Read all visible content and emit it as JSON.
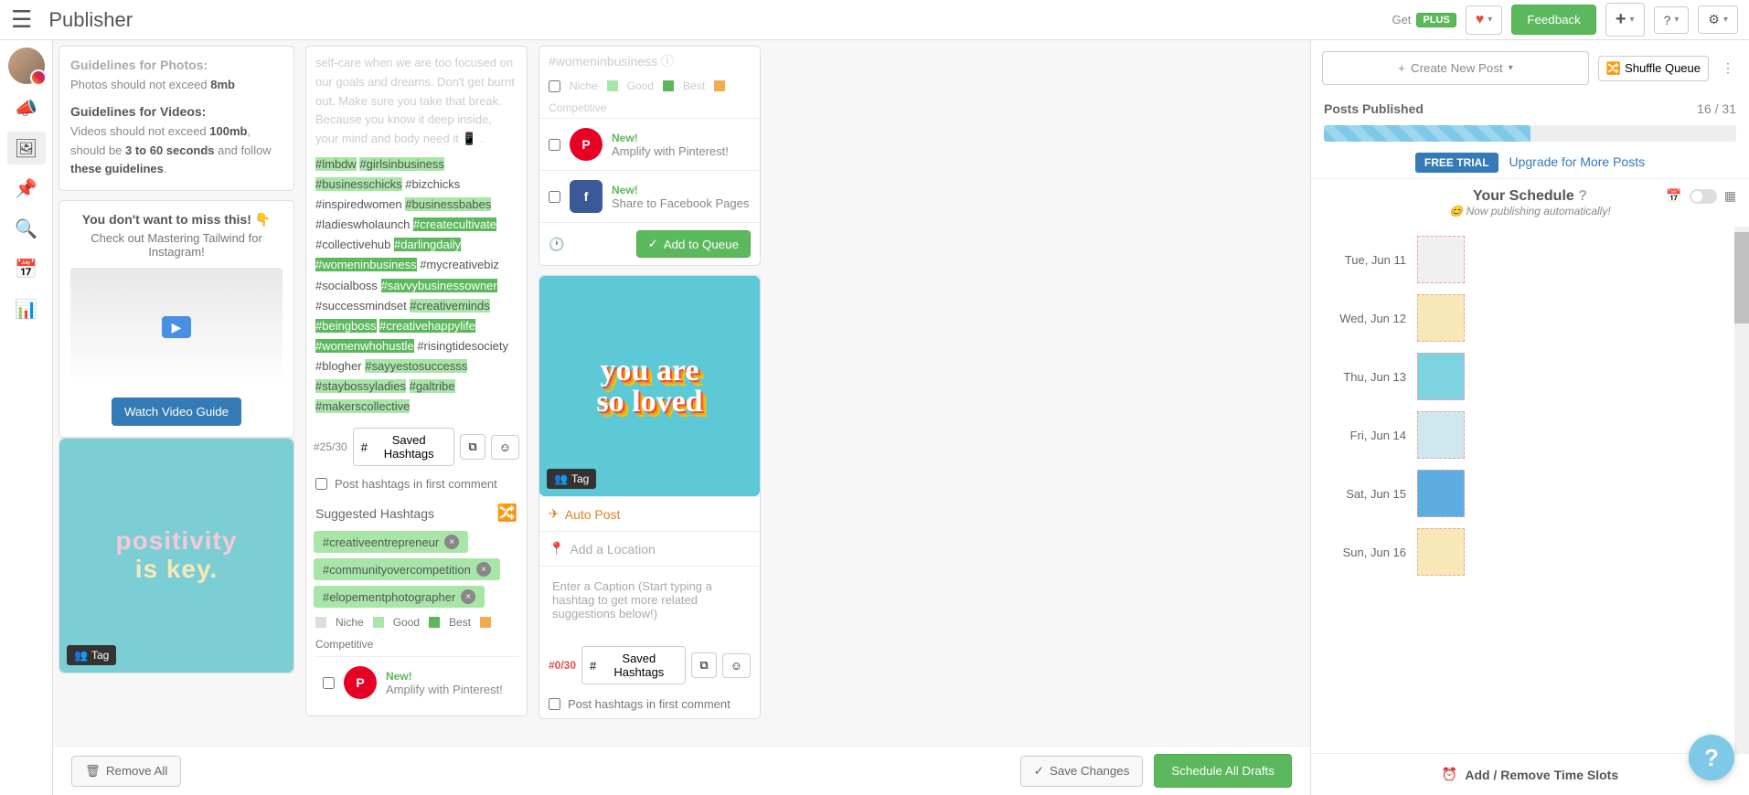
{
  "header": {
    "title": "Publisher",
    "get": "Get",
    "plus": "PLUS",
    "feedback": "Feedback"
  },
  "guidelines": {
    "photos_title": "Guidelines for Photos:",
    "photos_text_a": "Photos should not exceed ",
    "photos_text_b": "8mb",
    "videos_title": "Guidelines for Videos:",
    "videos_a": "Videos should not exceed ",
    "videos_b": "100mb",
    "videos_c": ", should be ",
    "videos_d": "3 to 60 seconds",
    "videos_e": " and follow ",
    "videos_f": "these guidelines",
    "videos_g": "."
  },
  "promo": {
    "title": "You don't want to miss this! ",
    "sub": "Check out Mastering Tailwind for Instagram!",
    "btn": "Watch Video Guide"
  },
  "img": {
    "positivity_a": "positivity",
    "positivity_b": "is key.",
    "loved_a": "you are",
    "loved_b": "so loved",
    "tag": "Tag"
  },
  "caption": {
    "body": "self-care when we are too focused on our goals and dreams. Don't get burnt out. Make sure you take that break. Because you know it deep inside, your mind and body need it 📱 ."
  },
  "hashtags_list": [
    {
      "t": "#lmbdw",
      "c": "green"
    },
    {
      "t": "#girlsinbusiness",
      "c": "green"
    },
    {
      "t": "#businesschicks",
      "c": "green"
    },
    {
      "t": "#bizchicks",
      "c": ""
    },
    {
      "t": "#inspiredwomen",
      "c": ""
    },
    {
      "t": "#businessbabes",
      "c": "green"
    },
    {
      "t": "#ladieswholaunch",
      "c": ""
    },
    {
      "t": "#createcultivate",
      "c": "darkgreen"
    },
    {
      "t": "#collectivehub",
      "c": ""
    },
    {
      "t": "#darlingdaily",
      "c": "darkgreen"
    },
    {
      "t": "#womeninbusiness",
      "c": "darkgreen"
    },
    {
      "t": "#mycreativebiz",
      "c": ""
    },
    {
      "t": "#socialboss",
      "c": ""
    },
    {
      "t": "#savvybusinessowner",
      "c": "darkgreen"
    },
    {
      "t": "#successmindset",
      "c": ""
    },
    {
      "t": "#creativeminds",
      "c": "green"
    },
    {
      "t": "#beingboss",
      "c": "darkgreen"
    },
    {
      "t": "#creativehappylife",
      "c": "darkgreen"
    },
    {
      "t": "#womenwhohustle",
      "c": "darkgreen"
    },
    {
      "t": "#risingtidesociety",
      "c": ""
    },
    {
      "t": "#blogher",
      "c": ""
    },
    {
      "t": "#sayyestosuccesss",
      "c": "green"
    },
    {
      "t": "#staybossyladies",
      "c": "green"
    },
    {
      "t": "#galtribe",
      "c": "green"
    },
    {
      "t": "#makerscollective",
      "c": "green"
    }
  ],
  "ctrls": {
    "count": "#25/30",
    "saved": "Saved Hashtags",
    "post_first": "Post hashtags in first comment",
    "suggested": "Suggested Hashtags"
  },
  "chips": [
    "#creativeentrepreneur",
    "#communityovercompetition",
    "#elopementphotographer"
  ],
  "legend": {
    "niche": "Niche",
    "good": "Good",
    "best": "Best",
    "comp": "Competitive"
  },
  "share": {
    "new": "New!",
    "pin": "Amplify with Pinterest!",
    "fb": "Share to Facebook Pages",
    "queue": "Add to Queue"
  },
  "post3": {
    "auto": "Auto Post",
    "loc": "Add a Location",
    "caption_ph": "Enter a Caption (Start typing a hashtag to get more related suggestions below!)",
    "count": "#0/30"
  },
  "right": {
    "create": "Create New Post",
    "shuffle": "Shuffle Queue",
    "published": "Posts Published",
    "pub_count": "16 / 31",
    "trial": "FREE TRIAL",
    "upgrade": "Upgrade for More Posts",
    "sched": "Your Schedule",
    "sched_sub": "Now publishing automatically!",
    "add_slots": "Add / Remove Time Slots"
  },
  "schedule": [
    {
      "d": "Tue, Jun 11",
      "c": "th1"
    },
    {
      "d": "Wed, Jun 12",
      "c": "th2"
    },
    {
      "d": "Thu, Jun 13",
      "c": "th3"
    },
    {
      "d": "Fri, Jun 14",
      "c": "th4"
    },
    {
      "d": "Sat, Jun 15",
      "c": "th5"
    },
    {
      "d": "Sun, Jun 16",
      "c": "th6"
    }
  ],
  "footer": {
    "remove": "Remove All",
    "save": "Save Changes",
    "schedule": "Schedule All Drafts"
  },
  "cut_hashtag": "#womeninbusiness"
}
